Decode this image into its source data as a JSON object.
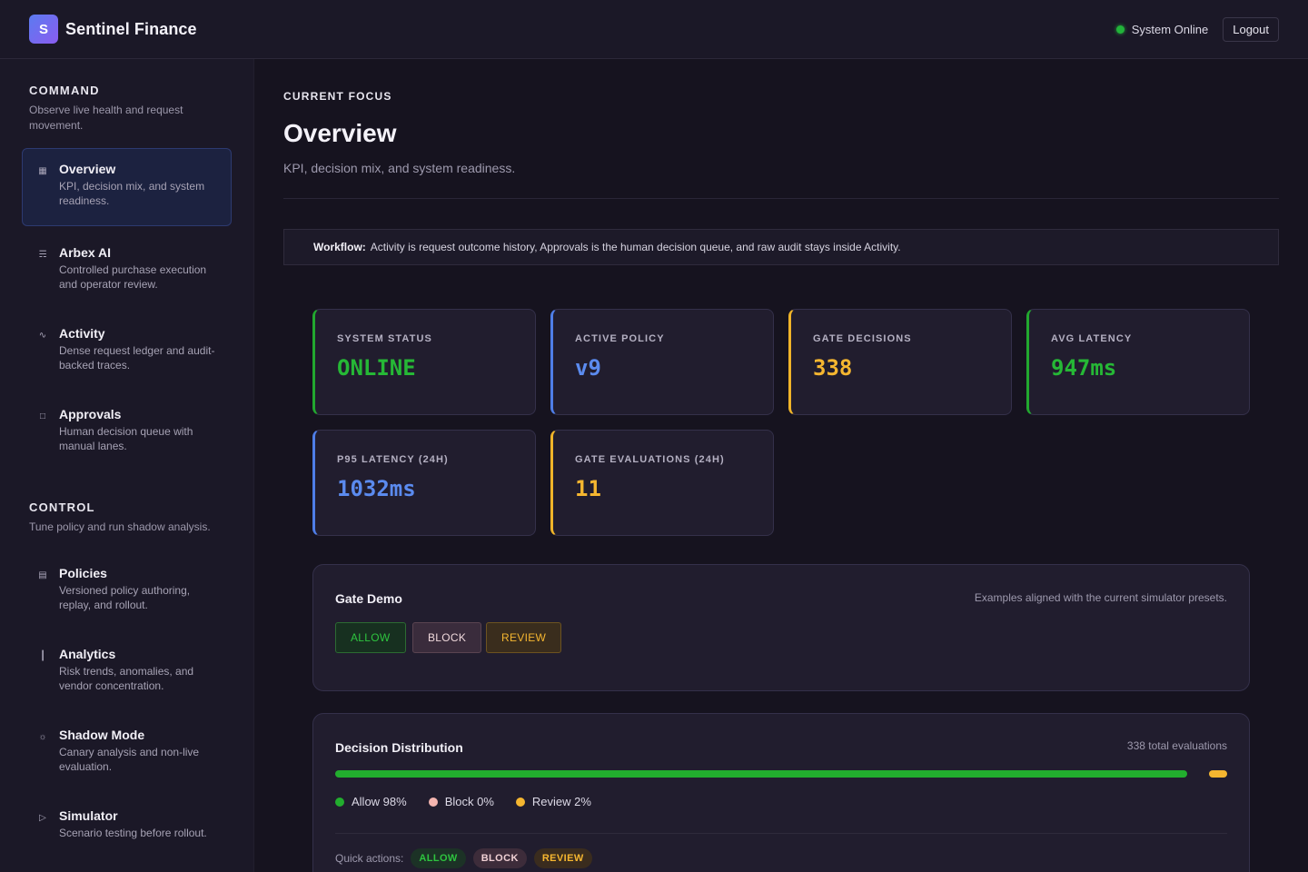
{
  "header": {
    "logo_letter": "S",
    "brand": "Sentinel Finance",
    "status": "System Online",
    "logout": "Logout"
  },
  "sidebar": {
    "sections": [
      {
        "title": "COMMAND",
        "desc": "Observe live health and request movement.",
        "items": [
          {
            "icon": "grid-icon",
            "label": "Overview",
            "desc": "KPI, decision mix, and system readiness.",
            "active": true
          },
          {
            "icon": "cart-icon",
            "label": "Arbex AI",
            "desc": "Controlled purchase execution and operator review."
          },
          {
            "icon": "pulse-icon",
            "label": "Activity",
            "desc": "Dense request ledger and audit-backed traces."
          },
          {
            "icon": "chat-icon",
            "label": "Approvals",
            "desc": "Human decision queue with manual lanes."
          }
        ]
      },
      {
        "title": "CONTROL",
        "desc": "Tune policy and run shadow analysis.",
        "items": [
          {
            "icon": "document-icon",
            "label": "Policies",
            "desc": "Versioned policy authoring, replay, and rollout."
          },
          {
            "icon": "bar-chart-icon",
            "label": "Analytics",
            "desc": "Risk trends, anomalies, and vendor concentration."
          },
          {
            "icon": "sun-icon",
            "label": "Shadow Mode",
            "desc": "Canary analysis and non-live evaluation."
          },
          {
            "icon": "play-icon",
            "label": "Simulator",
            "desc": "Scenario testing before rollout."
          }
        ]
      }
    ]
  },
  "main": {
    "eyebrow": "CURRENT FOCUS",
    "title": "Overview",
    "subtitle": "KPI, decision mix, and system readiness.",
    "workflow_label": "Workflow:",
    "workflow_text": "Activity is request outcome history, Approvals is the human decision queue, and raw audit stays inside Activity.",
    "kpis": [
      {
        "label": "SYSTEM STATUS",
        "value": "ONLINE",
        "color": "green"
      },
      {
        "label": "ACTIVE POLICY",
        "value": "v9",
        "color": "blue"
      },
      {
        "label": "GATE DECISIONS",
        "value": "338",
        "color": "yellow"
      },
      {
        "label": "AVG LATENCY",
        "value": "947ms",
        "color": "green"
      },
      {
        "label": "P95 LATENCY (24H)",
        "value": "1032ms",
        "color": "blue"
      },
      {
        "label": "GATE EVALUATIONS (24H)",
        "value": "11",
        "color": "yellow"
      }
    ],
    "gate_demo": {
      "title": "Gate Demo",
      "note": "Examples aligned with the current simulator presets.",
      "allow": "ALLOW",
      "block": "BLOCK",
      "review": "REVIEW"
    },
    "distribution": {
      "title": "Decision Distribution",
      "total": "338 total evaluations",
      "allow_fraction": 0.98,
      "block_fraction": 0.0,
      "review_fraction": 0.02,
      "allow_label": "Allow 98%",
      "block_label": "Block 0%",
      "review_label": "Review 2%",
      "quick_label": "Quick actions:",
      "quick_allow": "ALLOW",
      "quick_block": "BLOCK",
      "quick_review": "REVIEW"
    }
  },
  "colors": {
    "allow": "#22ad2e",
    "block": "#f4b5b0",
    "review": "#f5b630",
    "accent_blue": "#5b8bef"
  }
}
